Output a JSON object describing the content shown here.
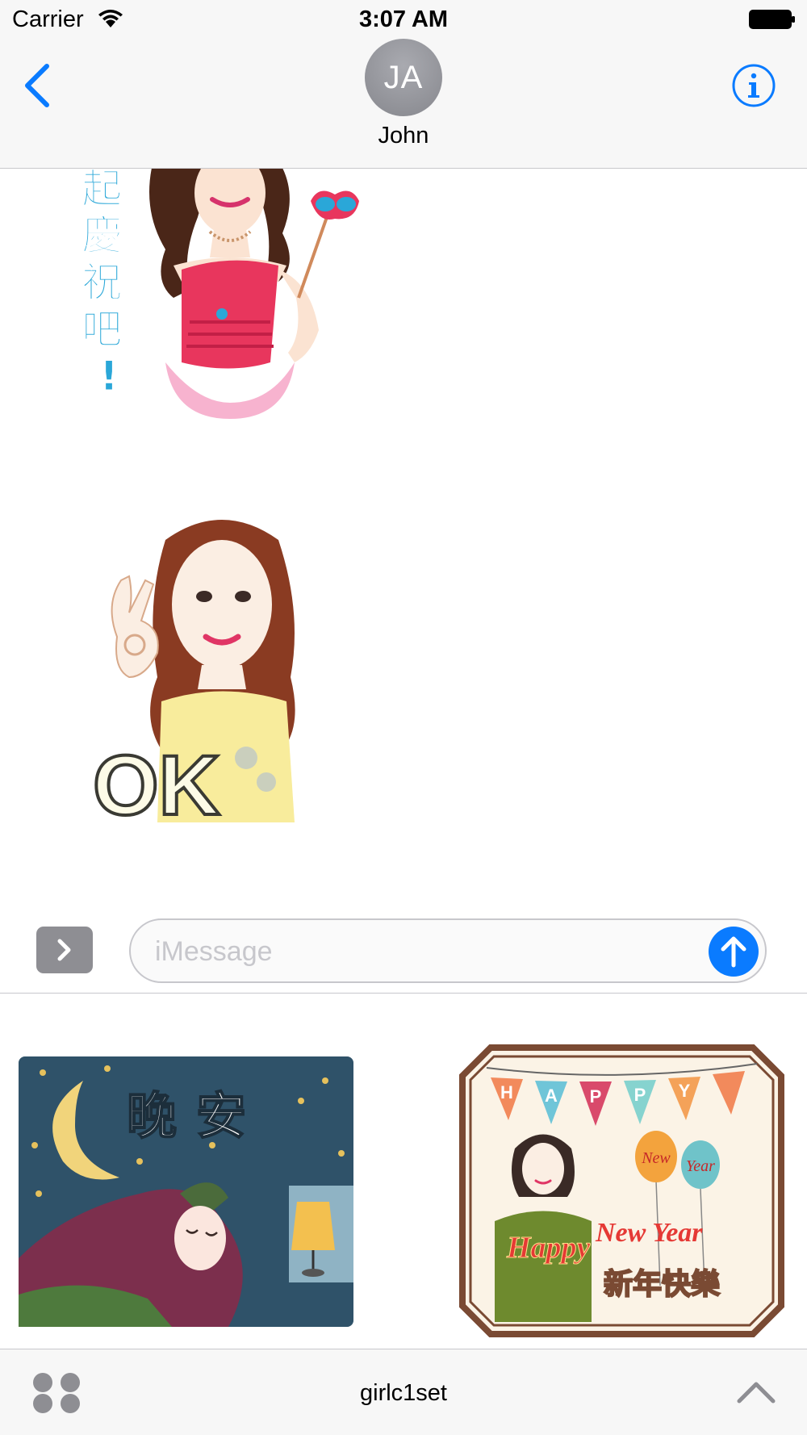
{
  "status_bar": {
    "carrier": "Carrier",
    "time": "3:07 AM",
    "icons": [
      "wifi-icon",
      "battery-icon"
    ]
  },
  "header": {
    "back_icon": "chevron-left-icon",
    "avatar_initials": "JA",
    "contact_name": "John",
    "info_icon": "info-circle-icon"
  },
  "transcript": {
    "stickers": [
      {
        "name": "celebrate-sticker",
        "caption": "起慶祝吧！"
      },
      {
        "name": "ok-sticker",
        "caption": "OK"
      }
    ]
  },
  "composer": {
    "expand_icon": "chevron-right-icon",
    "placeholder": "iMessage",
    "send_icon": "arrow-up-icon"
  },
  "drawer": {
    "stickers": [
      {
        "name": "good-night-sticker",
        "caption": "晚安"
      },
      {
        "name": "happy-new-year-sticker",
        "banner": "HAPPY",
        "balloon_1": "New",
        "balloon_2": "Year",
        "greeting_1": "Happy",
        "greeting_2": "New Year",
        "greeting_cn": "新年快樂"
      }
    ]
  },
  "app_bar": {
    "apps_icon": "app-grid-icon",
    "app_name": "girlc1set",
    "collapse_icon": "chevron-up-icon"
  },
  "colors": {
    "ios_blue": "#0a7bff",
    "bar_bg": "#f7f7f7",
    "avatar_gray": "#8e8f95"
  }
}
